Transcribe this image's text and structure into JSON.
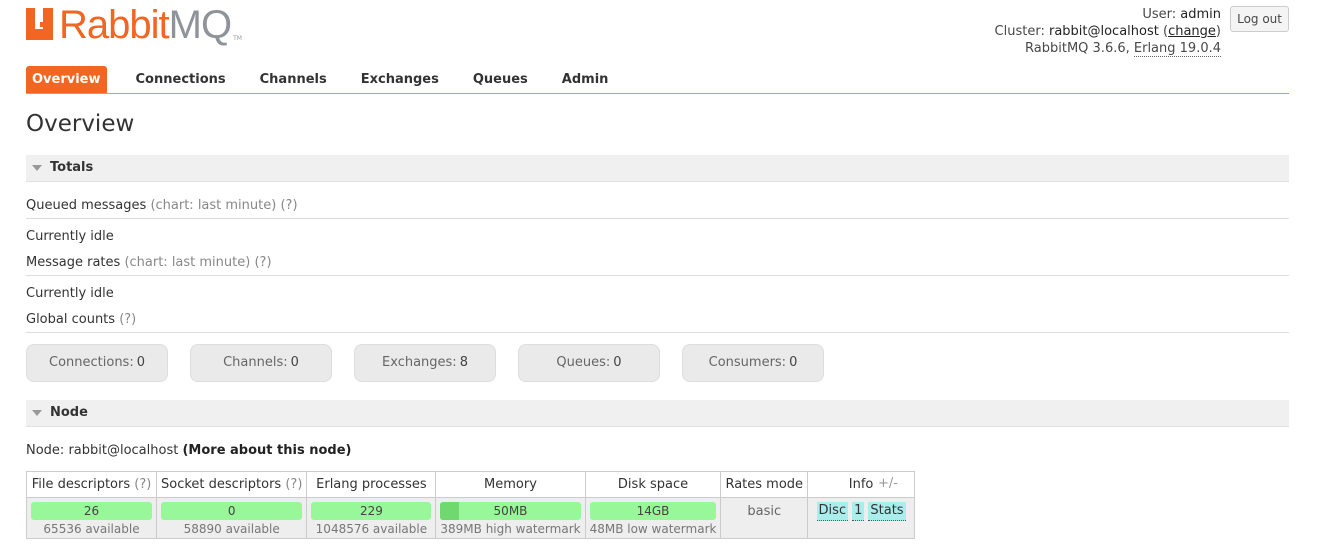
{
  "app": {
    "logo_part1": "Rabbit",
    "logo_part2": "MQ",
    "logo_tm": "TM"
  },
  "login": {
    "user_label": "User:",
    "user": "admin",
    "cluster_label": "Cluster:",
    "cluster": "rabbit@localhost",
    "change": "change",
    "version": "RabbitMQ 3.6.6,",
    "erlang": "Erlang 19.0.4",
    "logout": "Log out"
  },
  "tabs": [
    "Overview",
    "Connections",
    "Channels",
    "Exchanges",
    "Queues",
    "Admin"
  ],
  "page_title": "Overview",
  "totals": {
    "heading": "Totals",
    "queued_label": "Queued messages",
    "queued_chart": "(chart: last minute)",
    "queued_help": "(?)",
    "queued_status": "Currently idle",
    "rates_label": "Message rates",
    "rates_chart": "(chart: last minute)",
    "rates_help": "(?)",
    "rates_status": "Currently idle",
    "global_label": "Global counts",
    "global_help": "(?)"
  },
  "counts": [
    {
      "label": "Connections:",
      "value": "0"
    },
    {
      "label": "Channels:",
      "value": "0"
    },
    {
      "label": "Exchanges:",
      "value": "8"
    },
    {
      "label": "Queues:",
      "value": "0"
    },
    {
      "label": "Consumers:",
      "value": "0"
    }
  ],
  "node": {
    "heading": "Node",
    "node_label": "Node: rabbit@localhost",
    "more_link": "(More about this node)",
    "columns": {
      "file_desc": "File descriptors",
      "file_help": "(?)",
      "socket_desc": "Socket descriptors",
      "socket_help": "(?)",
      "erlang_proc": "Erlang processes",
      "memory": "Memory",
      "disk": "Disk space",
      "rates_mode": "Rates mode",
      "info": "Info"
    },
    "values": {
      "file_desc": "26",
      "file_avail": "65536 available",
      "socket_desc": "0",
      "socket_avail": "58890 available",
      "erlang_proc": "229",
      "erlang_avail": "1048576 available",
      "memory": "50MB",
      "memory_watermark": "389MB high watermark",
      "disk": "14GB",
      "disk_watermark": "48MB low watermark",
      "rates_mode": "basic",
      "info_disc": "Disc",
      "info_one": "1",
      "info_stats": "Stats"
    },
    "memory_fraction": 0.13,
    "plus_minus": "+/-"
  },
  "colors": {
    "brand": "#f26522",
    "bar_green": "#98f798",
    "info_badge": "#aaeded"
  }
}
